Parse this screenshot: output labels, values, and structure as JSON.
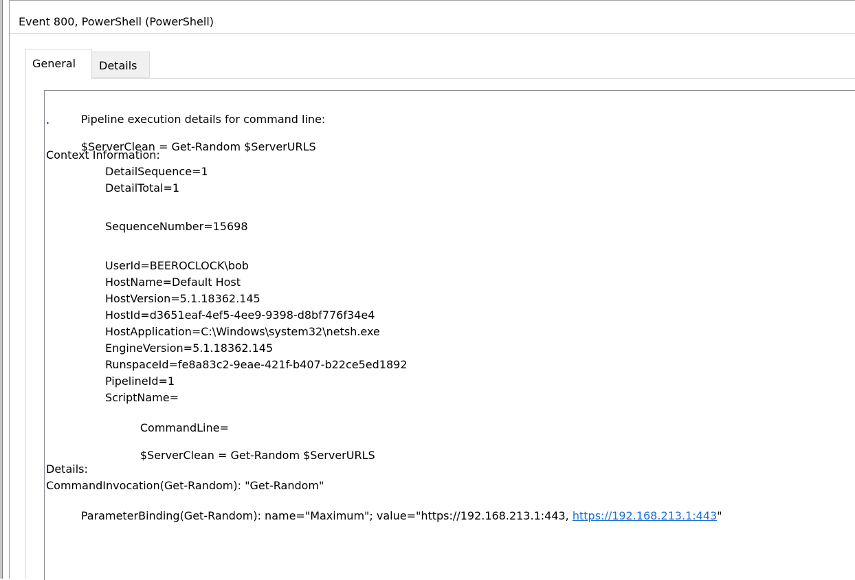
{
  "window": {
    "title": "Event 800, PowerShell (PowerShell)"
  },
  "tabs": [
    {
      "label": "General",
      "selected": true
    },
    {
      "label": "Details",
      "selected": false
    }
  ],
  "message": {
    "pipeline_label": "Pipeline execution details for command line:",
    "pipeline_command": "$ServerClean = Get-Random $ServerURLS",
    "dot": ".",
    "context_heading": "Context Information:",
    "detail_sequence": "DetailSequence=1",
    "detail_total": "DetailTotal=1",
    "sequence_number": "SequenceNumber=15698",
    "user_id": "UserId=BEEROCLOCK\\bob",
    "host_name": "HostName=Default Host",
    "host_version": "HostVersion=5.1.18362.145",
    "host_id": "HostId=d3651eaf-4ef5-4ee9-9398-d8bf776f34e4",
    "host_application": "HostApplication=C:\\Windows\\system32\\netsh.exe",
    "engine_version": "EngineVersion=5.1.18362.145",
    "runspace_id": "RunspaceId=fe8a83c2-9eae-421f-b407-b22ce5ed1892",
    "pipeline_id": "PipelineId=1",
    "script_name": "ScriptName=",
    "command_line_label": "CommandLine=",
    "command_line_value": "$ServerClean = Get-Random $ServerURLS",
    "details_heading": "Details:",
    "command_invocation": "CommandInvocation(Get-Random): \"Get-Random\"",
    "parameter_binding_prefix": "ParameterBinding(Get-Random): name=\"Maximum\"; value=\"https://192.168.213.1:443, ",
    "parameter_binding_link": "https://192.168.213.1:443",
    "parameter_binding_suffix": "\""
  },
  "colors": {
    "link": "#1a6fd1",
    "window_bg": "#f0f0f0",
    "panel_bg": "#ffffff"
  }
}
